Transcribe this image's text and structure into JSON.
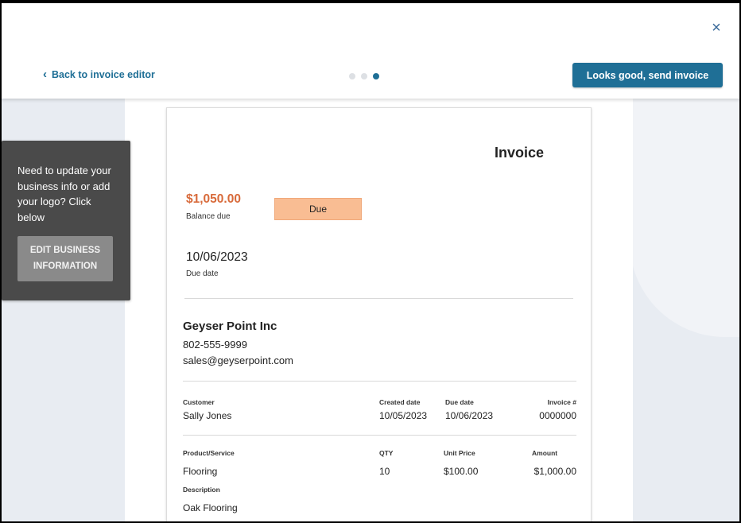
{
  "header": {
    "close_icon": "×",
    "back_label": "Back to invoice editor",
    "send_label": "Looks good, send invoice",
    "accent_color": "#1f6f96"
  },
  "tooltip": {
    "text": "Need to update your business info or add your logo? Click below",
    "button_label": "EDIT BUSINESS INFORMATION"
  },
  "invoice": {
    "title": "Invoice",
    "balance_amount": "$1,050.00",
    "balance_label": "Balance due",
    "status_badge": "Due",
    "due_date": "10/06/2023",
    "due_date_label": "Due date",
    "business": {
      "name": "Geyser Point Inc",
      "phone": "802-555-9999",
      "email": "sales@geyserpoint.com"
    },
    "meta": {
      "customer_label": "Customer",
      "customer": "Sally Jones",
      "created_label": "Created date",
      "created": "10/05/2023",
      "due_label": "Due date",
      "due": "10/06/2023",
      "invoice_no_label": "Invoice #",
      "invoice_no": "0000000"
    },
    "items_header": {
      "product": "Product/Service",
      "qty": "QTY",
      "unit_price": "Unit Price",
      "amount": "Amount"
    },
    "items": [
      {
        "product": "Flooring",
        "qty": "10",
        "unit_price": "$100.00",
        "amount": "$1,000.00",
        "description_label": "Description",
        "description": "Oak Flooring"
      }
    ]
  }
}
